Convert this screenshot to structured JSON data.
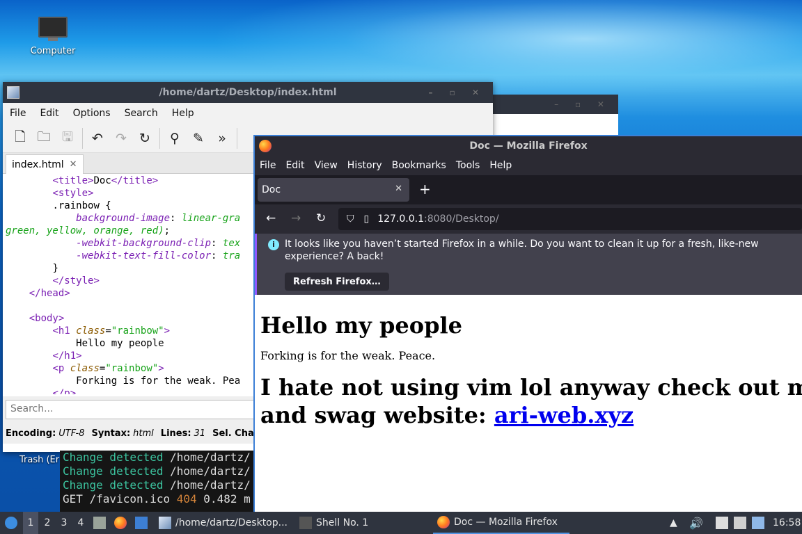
{
  "desktop": {
    "computer_icon_label": "Computer",
    "trash_label": "Trash (Er"
  },
  "editor": {
    "title": "/home/dartz/Desktop/index.html",
    "menu": [
      "File",
      "Edit",
      "Options",
      "Search",
      "Help"
    ],
    "tab_label": "index.html",
    "search_placeholder": "Search...",
    "status": {
      "encoding_label": "Encoding:",
      "encoding_value": "UTF-8",
      "syntax_label": "Syntax:",
      "syntax_value": "html",
      "lines_label": "Lines:",
      "lines_value": "31",
      "sel_label": "Sel. Char"
    },
    "code": {
      "l1_open": "<title>",
      "l1_text": "Doc",
      "l1_close": "</title>",
      "l2": "<style>",
      "l3": ".rainbow {",
      "l4_prop": "background-image",
      "l4_val": "linear-gra",
      "l5_val": "green, yellow, orange, red)",
      "l6_prop": "-webkit-background-clip",
      "l6_val": "tex",
      "l7_prop": "-webkit-text-fill-color",
      "l7_val": "tra",
      "l8": "}",
      "l9": "</style>",
      "l10": "</head>",
      "l12": "<body>",
      "l13_open": "<h1 ",
      "l13_attr": "class",
      "l13_str": "\"rainbow\"",
      "l14": "Hello my people",
      "l15": "</h1>",
      "l16_open": "<p ",
      "l16_attr": "class",
      "l16_str": "\"rainbow\"",
      "l17": "Forking is for the weak. Pea",
      "l18": "</p>"
    }
  },
  "terminal": {
    "lines": [
      {
        "a": "Change detected",
        "b": " /home/dartz/"
      },
      {
        "a": "Change detected",
        "b": " /home/dartz/"
      },
      {
        "a": "Change detected",
        "b": " /home/dartz/"
      }
    ],
    "last_prefix": "GET /favicon.ico ",
    "last_code": "404",
    "last_suffix": " 0.482 m"
  },
  "firefox": {
    "title": "Doc — Mozilla Firefox",
    "menu": [
      "File",
      "Edit",
      "View",
      "History",
      "Bookmarks",
      "Tools",
      "Help"
    ],
    "tab_label": "Doc",
    "url_host": "127.0.0.1",
    "url_path": ":8080/Desktop/",
    "notice_text": "It looks like you haven’t started Firefox in a while. Do you want to clean it up for a fresh, like-new experience? A back!",
    "notice_button": "Refresh Firefox…",
    "page": {
      "heading1": "Hello my people",
      "paragraph": "Forking is for the weak. Peace.",
      "heading2_line1": "I hate not using vim lol anyway check out m",
      "heading2_line2_prefix": "and swag website: ",
      "link_text": "ari-web.xyz"
    }
  },
  "taskbar": {
    "workspaces": [
      "1",
      "2",
      "3",
      "4"
    ],
    "tasks": [
      "/home/dartz/Desktop...",
      "Shell No. 1",
      "Doc — Mozilla Firefox"
    ],
    "clock": "16:58"
  }
}
